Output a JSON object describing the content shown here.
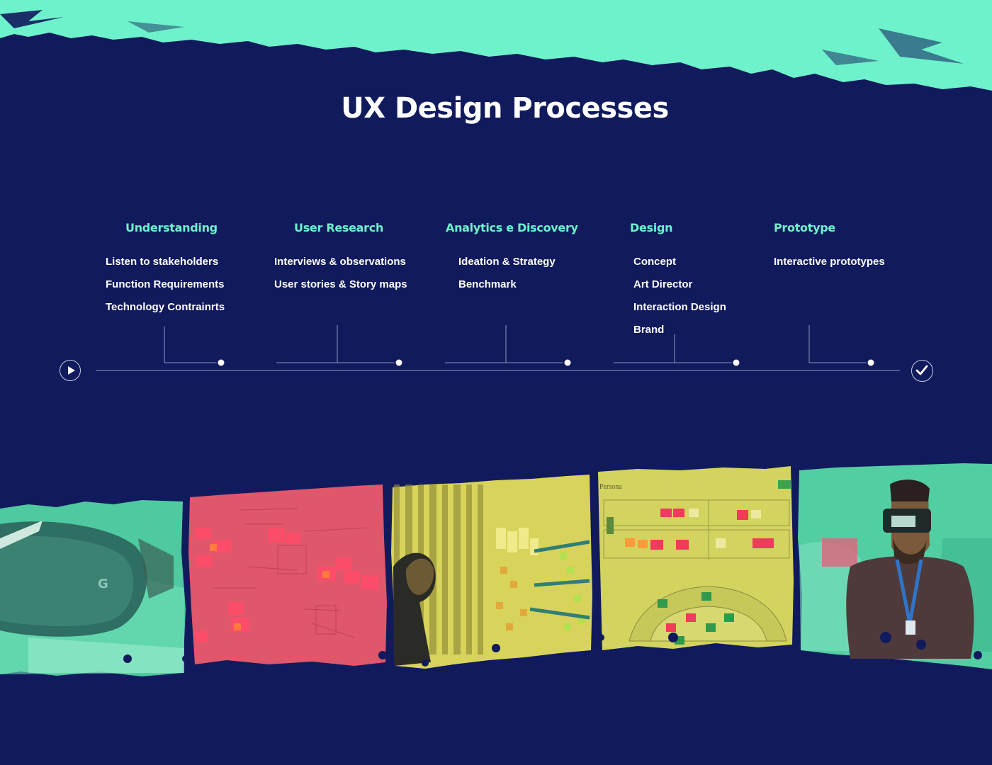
{
  "page": {
    "title": "UX Design Processes",
    "colors": {
      "background": "#111a5c",
      "accent": "#6ef2cb",
      "text": "#ffffff"
    }
  },
  "stages": [
    {
      "title": "Understanding",
      "items": [
        "Listen to stakeholders",
        "Function Requirements",
        "Technology Contrainrts"
      ]
    },
    {
      "title": "User Research",
      "items": [
        "Interviews & observations",
        "User stories & Story maps"
      ]
    },
    {
      "title": "Analytics e Discovery",
      "items": [
        "Ideation & Strategy",
        "Benchmark"
      ]
    },
    {
      "title": "Design",
      "items": [
        "Concept",
        "Art Director",
        "Interaction Design",
        "Brand"
      ]
    },
    {
      "title": "Prototype",
      "items": [
        "Interactive prototypes"
      ]
    }
  ],
  "timeline": {
    "start_icon": "play-icon",
    "end_icon": "checkmark-icon"
  },
  "photos": [
    {
      "name": "vr-headset-photo",
      "tint": "#5fd9ad"
    },
    {
      "name": "sticky-notes-whiteboard-photo",
      "tint": "#e0566a"
    },
    {
      "name": "team-wall-workshop-photo",
      "tint": "#d8d35a"
    },
    {
      "name": "persona-board-photo",
      "tint": "#d3d35f"
    },
    {
      "name": "vr-user-photo",
      "tint": "#52cfa2"
    }
  ]
}
